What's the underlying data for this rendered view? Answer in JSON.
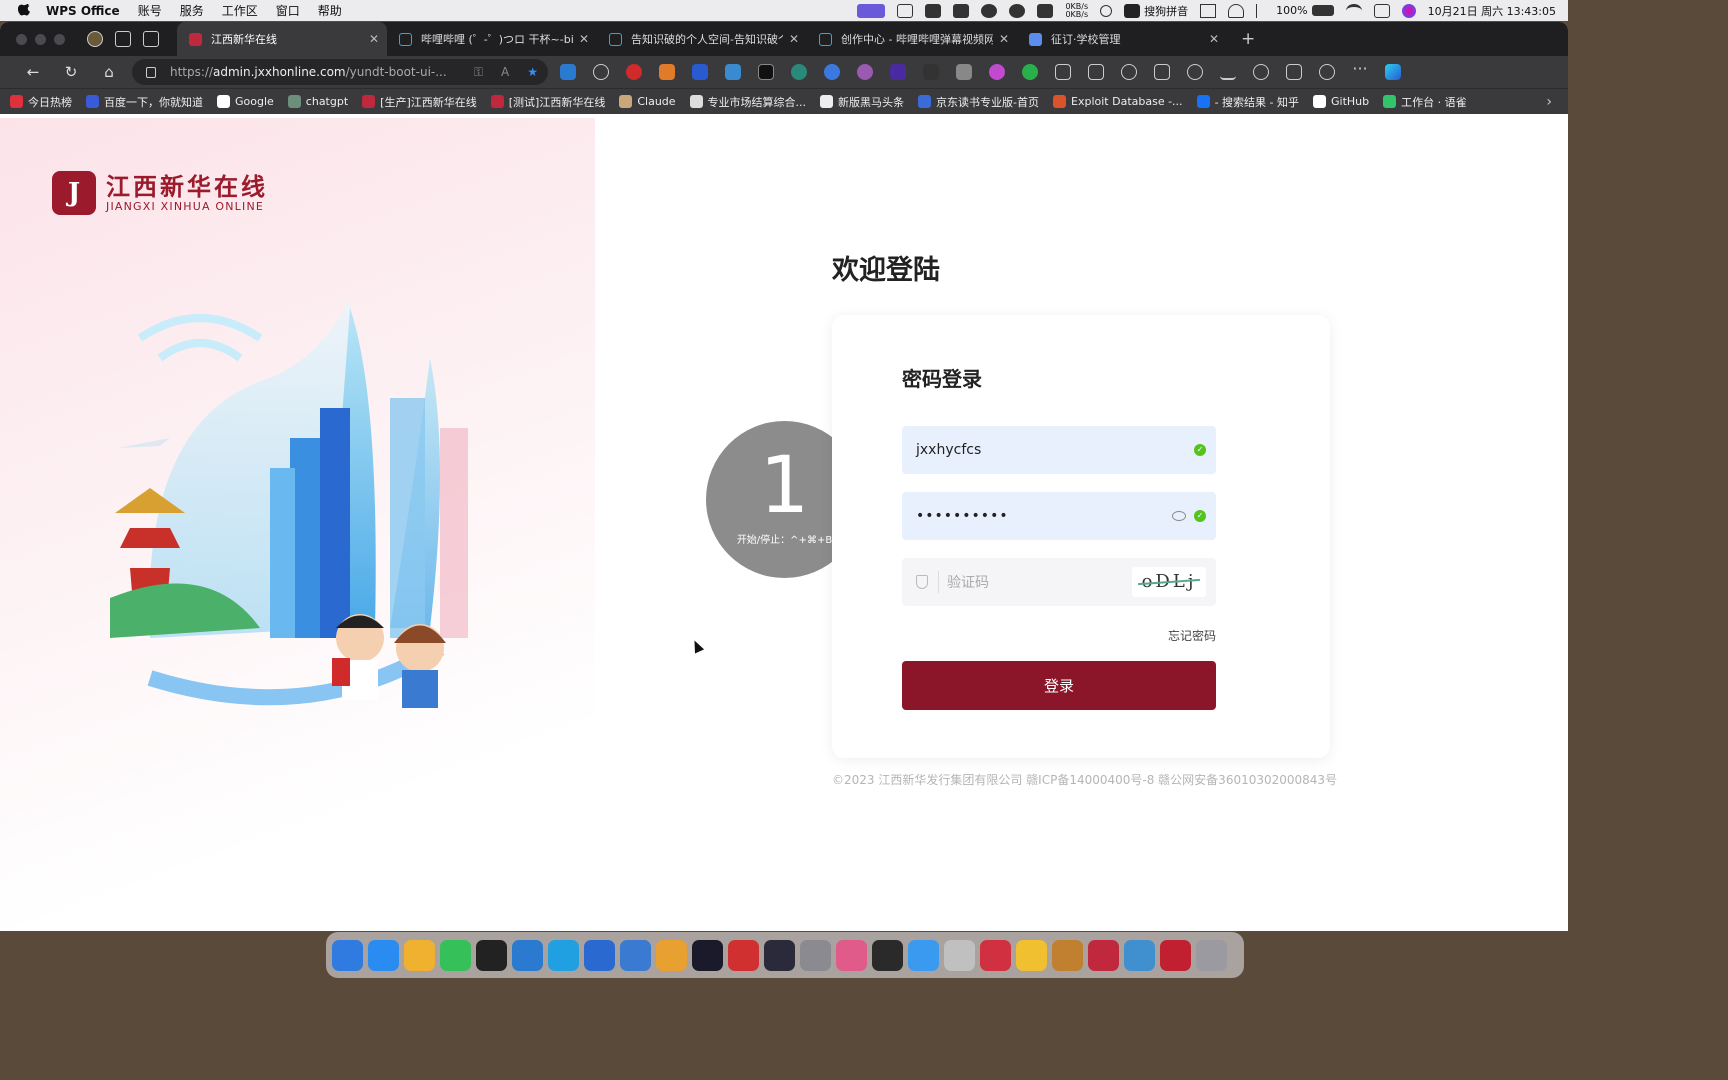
{
  "menubar": {
    "app": "WPS Office",
    "items": [
      "账号",
      "服务",
      "工作区",
      "窗口",
      "帮助"
    ],
    "net": "0KB/s",
    "ime": "搜狗拼音",
    "battery": "100%",
    "datetime": "10月21日 周六  13:43:05"
  },
  "tabs": [
    {
      "title": "江西新华在线",
      "color": "#c0283e"
    },
    {
      "title": "哔哩哔哩 (゜-゜)つロ 干杯~-bili",
      "color": "#2fa8e0"
    },
    {
      "title": "告知识破的个人空间-告知识破个",
      "color": "#2fa8e0"
    },
    {
      "title": "创作中心 - 哔哩哔哩弹幕视频网",
      "color": "#2fa8e0"
    },
    {
      "title": "征订·学校管理",
      "color": "#5b8def"
    }
  ],
  "url": {
    "prefix": "https://",
    "host": "admin.jxxhonline.com",
    "path": "/yundt-boot-ui-..."
  },
  "bookmarks": [
    {
      "label": "今日热榜",
      "color": "#e0303b"
    },
    {
      "label": "百度一下，你就知道",
      "color": "#3a5bd9"
    },
    {
      "label": "Google",
      "color": "#ffffff"
    },
    {
      "label": "chatgpt",
      "color": "#6b8f7a"
    },
    {
      "label": "[生产]江西新华在线",
      "color": "#c0283e"
    },
    {
      "label": "[测试]江西新华在线",
      "color": "#c0283e"
    },
    {
      "label": "Claude",
      "color": "#c8a87a"
    },
    {
      "label": "专业市场结算综合...",
      "color": "#dddddd"
    },
    {
      "label": "新版黑马头条",
      "color": "#eeeeee"
    },
    {
      "label": "京东读书专业版-首页",
      "color": "#3a6bd9"
    },
    {
      "label": "Exploit Database -...",
      "color": "#d9532c"
    },
    {
      "label": "- 搜索结果 - 知乎",
      "color": "#1772f6"
    },
    {
      "label": "GitHub",
      "color": "#ffffff"
    },
    {
      "label": "工作台 · 语雀",
      "color": "#31c46a"
    }
  ],
  "brand": {
    "mark": "J",
    "name_cn": "江西新华在线",
    "name_en": "JIANGXI XINHUA ONLINE",
    "color": "#9b1b2c"
  },
  "recorder": {
    "number": "1",
    "hint": "开始/停止：^+⌘+B"
  },
  "login": {
    "welcome": "欢迎登陆",
    "title": "密码登录",
    "username": "jxxhycfcs",
    "password": "••••••••••",
    "captcha_placeholder": "验证码",
    "captcha_text": "oDLj",
    "forgot": "忘记密码",
    "submit": "登录",
    "button_color": "#8c1629"
  },
  "footer": "©2023 江西新华发行集团有限公司 赣ICP备14000400号-8 赣公网安备36010302000843号",
  "dock_colors": [
    "#2f7be0",
    "#2a8cf0",
    "#f0b030",
    "#35c05a",
    "#222222",
    "#2a7bd0",
    "#20a0e0",
    "#2a6ad0",
    "#3a7ad0",
    "#e8a030",
    "#1a1a2a",
    "#d03030",
    "#2a2a3a",
    "#8a8a90",
    "#e05a8a",
    "#2a2a2a",
    "#3a9af0",
    "#c0c0c0",
    "#d03040",
    "#f0c030",
    "#c08030",
    "#c0283e",
    "#4090d0",
    "#c02030",
    "#9a9aa0"
  ]
}
